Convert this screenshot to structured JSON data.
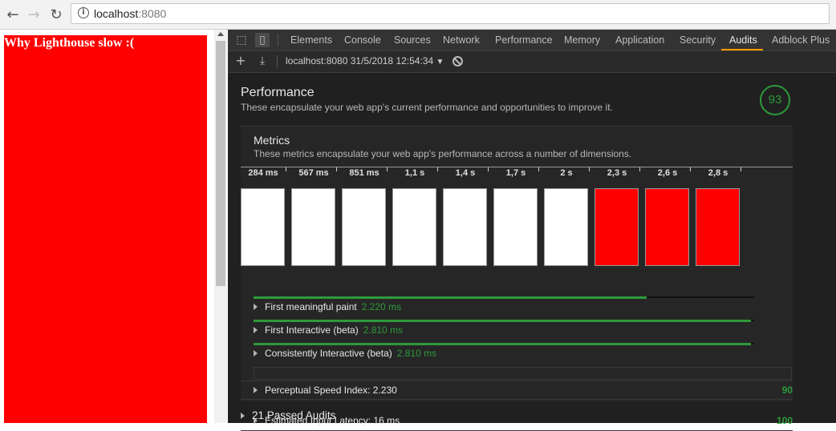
{
  "browser": {
    "url_host": "localhost",
    "url_port": ":8080"
  },
  "page": {
    "text": "Why Lighthouse slow :(",
    "background_color": "#ff0000"
  },
  "devtools": {
    "tabs": [
      "Elements",
      "Console",
      "Sources",
      "Network",
      "Performance",
      "Memory",
      "Application",
      "Security",
      "Audits",
      "Adblock Plus"
    ],
    "active_tab": "Audits",
    "report": "localhost:8080 31/5/2018 12:54:34",
    "performance": {
      "title": "Performance",
      "description": "These encapsulate your web app's current performance and opportunities to improve it.",
      "score": "93"
    },
    "metrics": {
      "title": "Metrics",
      "description": "These metrics encapsulate your web app's performance across a number of dimensions.",
      "timeline_labels": [
        "284 ms",
        "567 ms",
        "851 ms",
        "1,1 s",
        "1,4 s",
        "1,7 s",
        "2 s",
        "2,3 s",
        "2,6 s",
        "2,8 s"
      ],
      "frame_colors": [
        "#ffffff",
        "#ffffff",
        "#ffffff",
        "#ffffff",
        "#ffffff",
        "#ffffff",
        "#ffffff",
        "#ff0000",
        "#ff0000",
        "#ff0000"
      ],
      "items": [
        {
          "label": "First meaningful paint",
          "value": "2.220 ms",
          "progress": 0.79
        },
        {
          "label": "First Interactive (beta)",
          "value": "2.810 ms",
          "progress": 1.0
        },
        {
          "label": "Consistently Interactive (beta)",
          "value": "2.810 ms",
          "progress": 1.0
        }
      ],
      "perceptual_speed_index": {
        "label": "Perceptual Speed Index: 2.230",
        "score": "90"
      },
      "estimated_input_latency": {
        "label": "Estimated Input Latency: 16 ms",
        "score": "100"
      }
    },
    "passed_audits": "21 Passed Audits"
  },
  "colors": {
    "accent_green": "#2d9a3a",
    "tab_underline": "#ff9c00"
  }
}
